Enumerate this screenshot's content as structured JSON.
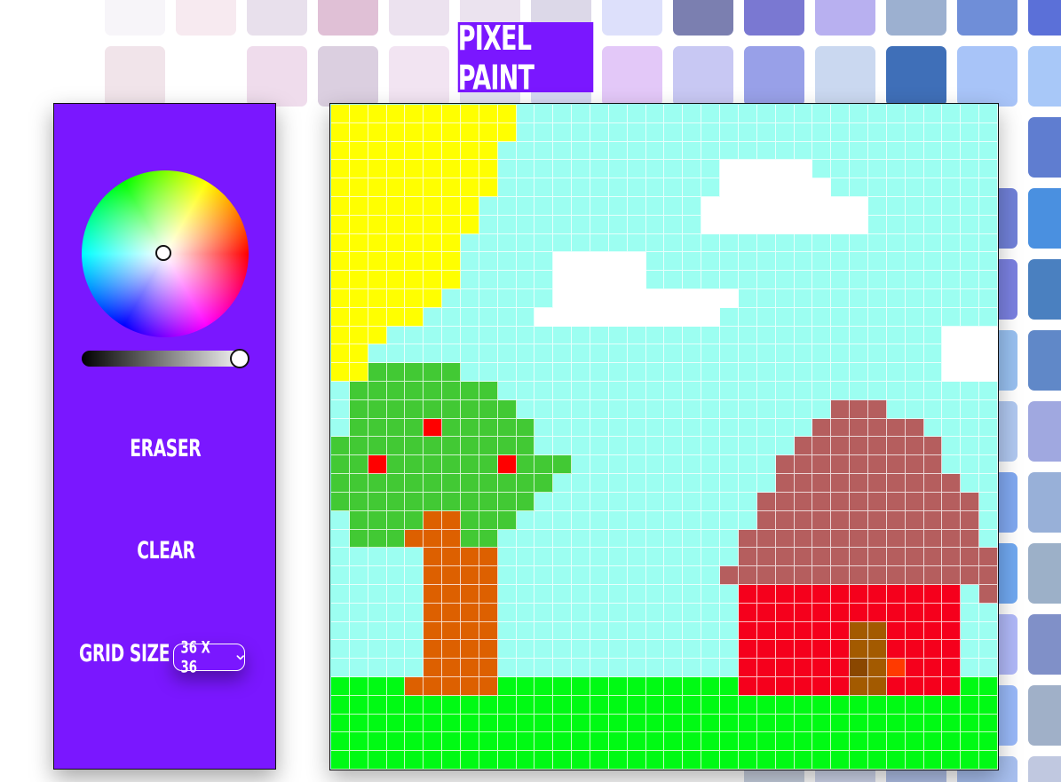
{
  "app": {
    "title": "PIXEL PAINT"
  },
  "controls": {
    "eraser_label": "ERASER",
    "clear_label": "CLEAR",
    "grid_size_label": "GRID SIZE",
    "grid_size_value": "36 X 36",
    "selected_color": "#ffffff",
    "brightness": 1.0
  },
  "icons": {
    "select_arrow": "chevron-down-icon"
  },
  "colors": {
    "accent": "#7a17ff",
    "panel_border": "#111111"
  },
  "canvas": {
    "cols": 36,
    "rows": 36,
    "palette": {
      "s": "#9cfef1",
      "y": "#ffff00",
      "w": "#ffffff",
      "g": "#42c934",
      "r": "#ff0000",
      "t": "#dd6000",
      "o": "#b55e5e",
      "h": "#f5001c",
      "d": "#a35a00",
      "k": "#8a4700",
      "f": "#ff3a00",
      "G": "#00fa14"
    },
    "rows_data": [
      "yyyyyyyyyyssssssssssssssssssssssssss",
      "yyyyyyyyyyssssssssssssssssssssssssss",
      "yyyyyyyyysssssssssssssssssssssssssss",
      "yyyyyyyyysssssssssssswwwwwssssssssss",
      "yyyyyyyyysssssssssssswwwwwwsssssssss",
      "yyyyyyyysssssssssssswwwwwwwwwsssssss",
      "yyyyyyyysssssssssssswwwwwwwwwsssssss",
      "yyyyyyysssssssssssssssssssssssssssss",
      "yyyyyyyssssswwwwwsssssssssssssssssss",
      "yyyyyyyssssswwwwwsssssssssssssssssss",
      "yyyyyysssssswwwwwwwwwwssssssssssssss",
      "yyyyysssssswwwwwwwwwwsssssssssssssss",
      "yyysssssssssssssssssssssssssssssswww",
      "yyssssssssssssssssssssssssssssssswww",
      "yygggggsssssssssssssssssssssssssswww",
      "sggggggggsssssssssssssssssssssssssss",
      "sgggggggggsssssssssssssssssooosssssss",
      "sggggrgggggsssssssssssssssoooooossss",
      "gggggggggggssssssssssssssoooooooosss",
      "ggrggggggrgggsssssssssssoooooooooss",
      "ggggggggggggssssssssssssoooooooooos",
      "gggggggggggssssssssssssoooooooooooos",
      "sggggttgggsssssssssssssoooooooooooos",
      "sgggtttggsssssssssssssooooooooooooo",
      "sssssttttsssssssssssssoooooooooooooo",
      "sssssttttssssssssssssooooooooooooooo",
      "sssssttttssssssssssssshhhhhhhhhhhhso",
      "sssssttttssssssssssssshhhhhhhhhhhhss",
      "sssssttttssssssssssssshhhhhhddhhhhss",
      "sssssttttssssssssssssshhhhhhddhhhhss",
      "sssssttttssssssssssssshhhhhhkdfhhhss",
      "GGGGtttttGGGGGGGGGGGGGhhhhhhddhhhhGG",
      "GGGGGGGGGGGGGGGGGGGGGGGGGGGGGGGGGGGG",
      "GGGGGGGGGGGGGGGGGGGGGGGGGGGGGGGGGGGG",
      "GGGGGGGGGGGGGGGGGGGGGGGGGGGGGGGGGGGG",
      "GGGGGGGGGGGGGGGGGGGGGGGGGGGGGGGGGGGG"
    ]
  },
  "background": {
    "swatch_colors": [
      "#f7f5f9",
      "#f7eaf0",
      "#e8e0ec",
      "#e0c0d6",
      "#ece2ef",
      "#ebe3ef",
      "#dcd8e8",
      "#dde0fb",
      "#7b7fb0",
      "#7a78d2",
      "#b8b0f0",
      "#9cb0d0",
      "#6f8ed8",
      "#5b70d8",
      "#f1e4ea",
      "#ffffff",
      "#efdcec",
      "#dbcfe0",
      "#f2e4f2",
      "#e2dff2",
      "#d6d8f3",
      "#e3c8f8",
      "#c8c8f3",
      "#98a0e8",
      "#cad8f0",
      "#3f6fb8",
      "#a8c4f8",
      "#a8c8f8",
      "#e6e6ee",
      "#ffffff",
      "#ffffff"
    ]
  }
}
